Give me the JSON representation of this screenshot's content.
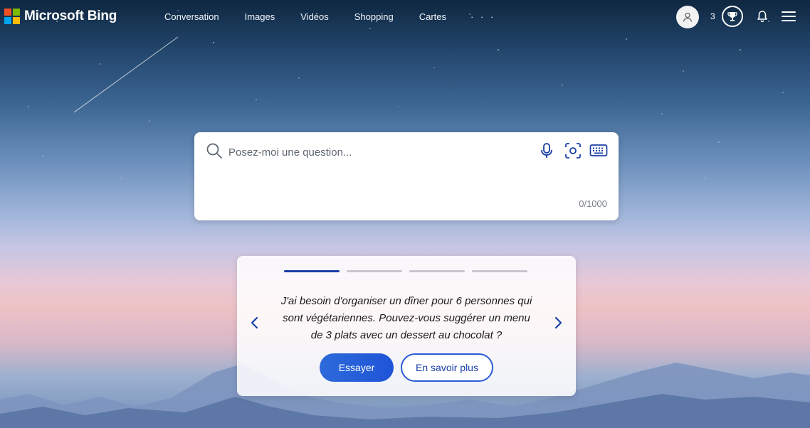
{
  "header": {
    "logo_text": "Microsoft Bing",
    "nav": {
      "conversation": "Conversation",
      "images": "Images",
      "videos": "Vidéos",
      "shopping": "Shopping",
      "maps": "Cartes",
      "more": "· · ·"
    },
    "reward_count": "3",
    "icons": {
      "avatar": "user-icon",
      "rewards": "trophy-icon",
      "notifications": "bell-icon",
      "menu": "hamburger-icon"
    }
  },
  "search": {
    "placeholder": "Posez-moi une question...",
    "value": "",
    "char_count": "0/1000",
    "icons": [
      "search-icon",
      "microphone-icon",
      "visual-search-icon",
      "keyboard-icon"
    ]
  },
  "suggestion": {
    "carousel_total": 4,
    "carousel_active": 1,
    "text": "J'ai besoin d'organiser un dîner pour 6 personnes qui sont végétariennes. Pouvez-vous suggérer un menu de 3 plats avec un dessert au chocolat ?",
    "try_button": "Essayer",
    "learn_more_button": "En savoir plus"
  },
  "colors": {
    "accent": "#1a3fa8",
    "button_primary": "#2462d8",
    "ms_red": "#f25022",
    "ms_green": "#7fba00",
    "ms_blue": "#00a4ef",
    "ms_yellow": "#ffb900"
  }
}
